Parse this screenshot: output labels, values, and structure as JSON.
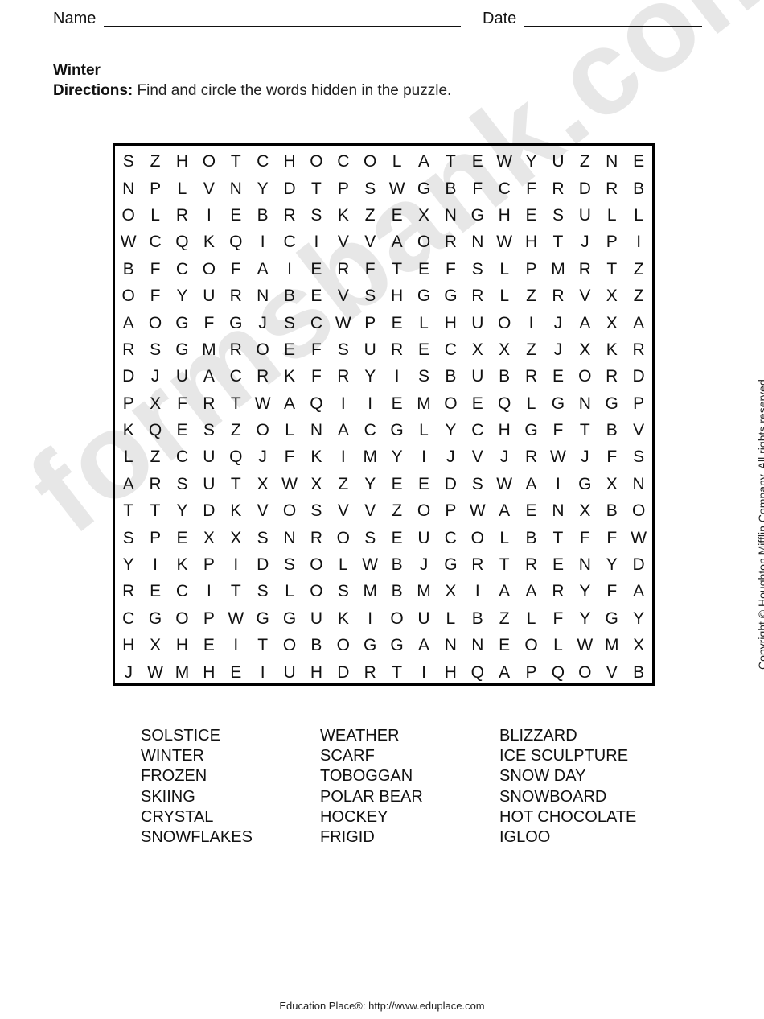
{
  "header": {
    "name_label": "Name",
    "date_label": "Date",
    "name_value": "",
    "date_value": ""
  },
  "worksheet": {
    "title": "Winter",
    "directions_label": "Directions:",
    "directions_text": " Find and circle the words hidden in the puzzle."
  },
  "puzzle": {
    "rows": [
      "SZHOTCHOCOLATEWYUZNE",
      "NPLVNYDTPSWGBFCFRDRB",
      "OLRIEBRSKZEXNGHESULL",
      "WCQKQICIVVAORNWHTJPI",
      "BFCOFAIERFTEFSLPMRTZ",
      "OFYURNBEVSHGGRLZRVXZ",
      "AOGFGJSCWPELHUOIJAXA",
      "RSGMROEFSURECXXZJXKR",
      "DJUACRKFRYISBUBREORD",
      "PXFRTWAQIIEMOEQLGNGP",
      "KQESZOLNACGLYCHGFTBV",
      "LZCUQJFKIMYIJVJRWJFS",
      "ARSUTXWXZYEEDSWAIGXN",
      "TTYDKVOSVVZOPWAENXBO",
      "SPEXXSNROSEUCOLBTFFW",
      "YIKPIDSOLWBJGRTRENYD",
      "RECITSLOSMBMXIAARYFA",
      "CGOPWGGUKIOULBZLFYGY",
      "HXHEITOBOGGANNEOLWMX",
      "JWMHEIUHDRTIHQAPQOVB"
    ]
  },
  "word_list": {
    "columns": [
      [
        "SOLSTICE",
        "WINTER",
        "FROZEN",
        "SKIING",
        "CRYSTAL",
        "SNOWFLAKES"
      ],
      [
        "WEATHER",
        "SCARF",
        "TOBOGGAN",
        "POLAR BEAR",
        "HOCKEY",
        "FRIGID"
      ],
      [
        "BLIZZARD",
        "ICE SCULPTURE",
        "SNOW DAY",
        "SNOWBOARD",
        "HOT CHOCOLATE",
        "IGLOO"
      ]
    ]
  },
  "copyright": "Copyright © Houghton Mifflin Company. All rights reserved.",
  "footer": "Education Place®: http://www.eduplace.com",
  "watermark": "formsbank.com"
}
